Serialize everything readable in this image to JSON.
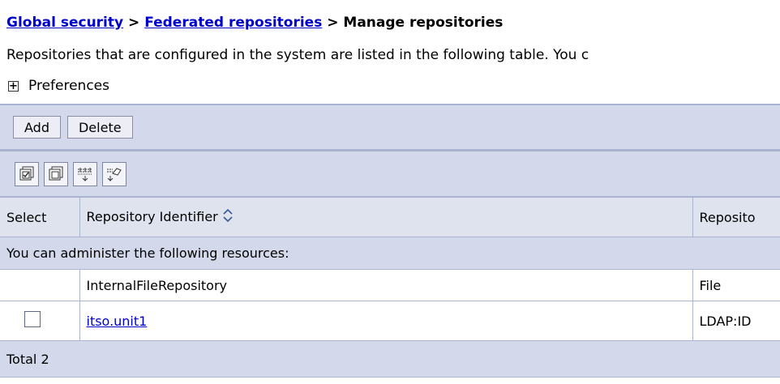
{
  "breadcrumb": {
    "global_security": "Global security",
    "sep1": " > ",
    "federated": "Federated repositories",
    "sep2": " > ",
    "current": "Manage repositories"
  },
  "intro_text": "Repositories that are configured in the system are listed in the following table. You c",
  "preferences": {
    "label": "Preferences",
    "toggle": "+"
  },
  "toolbar": {
    "add_label": "Add",
    "delete_label": "Delete"
  },
  "icon_toolbar": [
    "select-all-icon",
    "deselect-all-icon",
    "show-filter-icon",
    "clear-filter-icon"
  ],
  "table": {
    "headers": {
      "select": "Select",
      "identifier": "Repository Identifier",
      "type": "Reposito"
    },
    "resource_note": "You can administer the following resources:",
    "rows": [
      {
        "identifier": "InternalFileRepository",
        "type": "File",
        "selectable": false,
        "link": false
      },
      {
        "identifier": "itso.unit1",
        "type": "LDAP:ID",
        "selectable": true,
        "link": true
      }
    ],
    "total": "Total 2"
  },
  "colors": {
    "link": "#0000cc",
    "bar": "#d3d9ea",
    "header": "#dfe3ee",
    "border": "#aab3cf"
  }
}
